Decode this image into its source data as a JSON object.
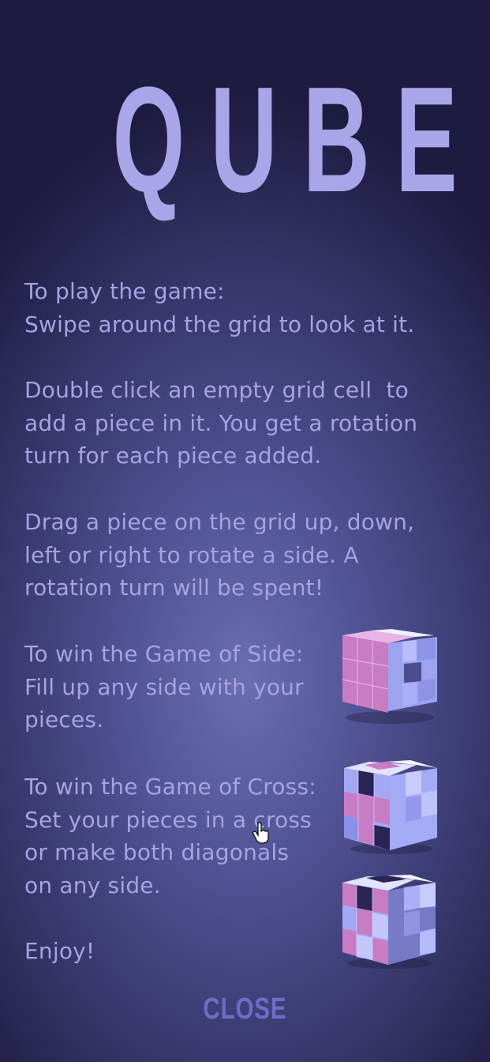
{
  "title": "QUBE",
  "instructions": {
    "play": "To play the game:\nSwipe around the grid to look at it.",
    "add": "Double click an empty grid cell  to\nadd a piece in it. You get a rotation\nturn for each piece added.",
    "rotate": "Drag a piece on the grid up, down,\nleft or right to rotate a side. A\nrotation turn will be spent!",
    "side": "To win the Game of Side:\nFill up any side with your\npieces.",
    "cross": "To win the Game of Cross:\nSet your pieces in a cross\nor make both diagonals\non any side.",
    "enjoy": "Enjoy!"
  },
  "close_label": "CLOSE",
  "colors": {
    "title": "#a8a6e8",
    "text": "#a6a3e2",
    "close": "#6f6bc7",
    "piece_pink": "#c77cc4",
    "piece_blue": "#a9acf5",
    "piece_dark": "#2b2456"
  },
  "icons": [
    "cube-side-icon",
    "cube-cross-icon",
    "cube-diagonal-icon",
    "hand-cursor-icon"
  ]
}
